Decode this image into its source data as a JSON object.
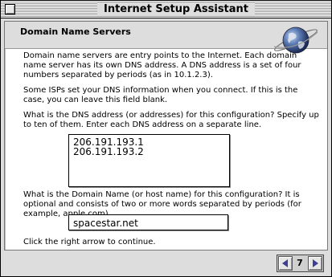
{
  "window": {
    "title": "Internet Setup Assistant"
  },
  "header": {
    "title": "Domain Name Servers",
    "icon": "globe-icon"
  },
  "body": {
    "paragraph1": "Domain name servers are entry points to the Internet.  Each domain name server has its own DNS address. A DNS address is a set of four numbers separated by periods (as in 10.1.2.3).",
    "paragraph2": "Some ISPs set your DNS information when you connect.  If this is the case, you can leave this field blank.",
    "dns_prompt": "What is the DNS address (or addresses) for this configuration?  Specify up to ten of them.  Enter each DNS address on a separate line.",
    "dns_entries": [
      "206.191.193.1",
      "206.191.193.2"
    ],
    "domain_prompt": "What is the Domain Name (or host name) for this configuration?  It is optional and consists of two or more words separated by periods (for example, apple.com)",
    "domain_value": "spacestar.net",
    "continue_text": "Click the right arrow to continue."
  },
  "nav": {
    "page_number": "7",
    "prev_icon": "left-arrow-icon",
    "next_icon": "right-arrow-icon"
  },
  "colors": {
    "arrow": "#3f3f8f",
    "window_bg": "#dddddd"
  }
}
